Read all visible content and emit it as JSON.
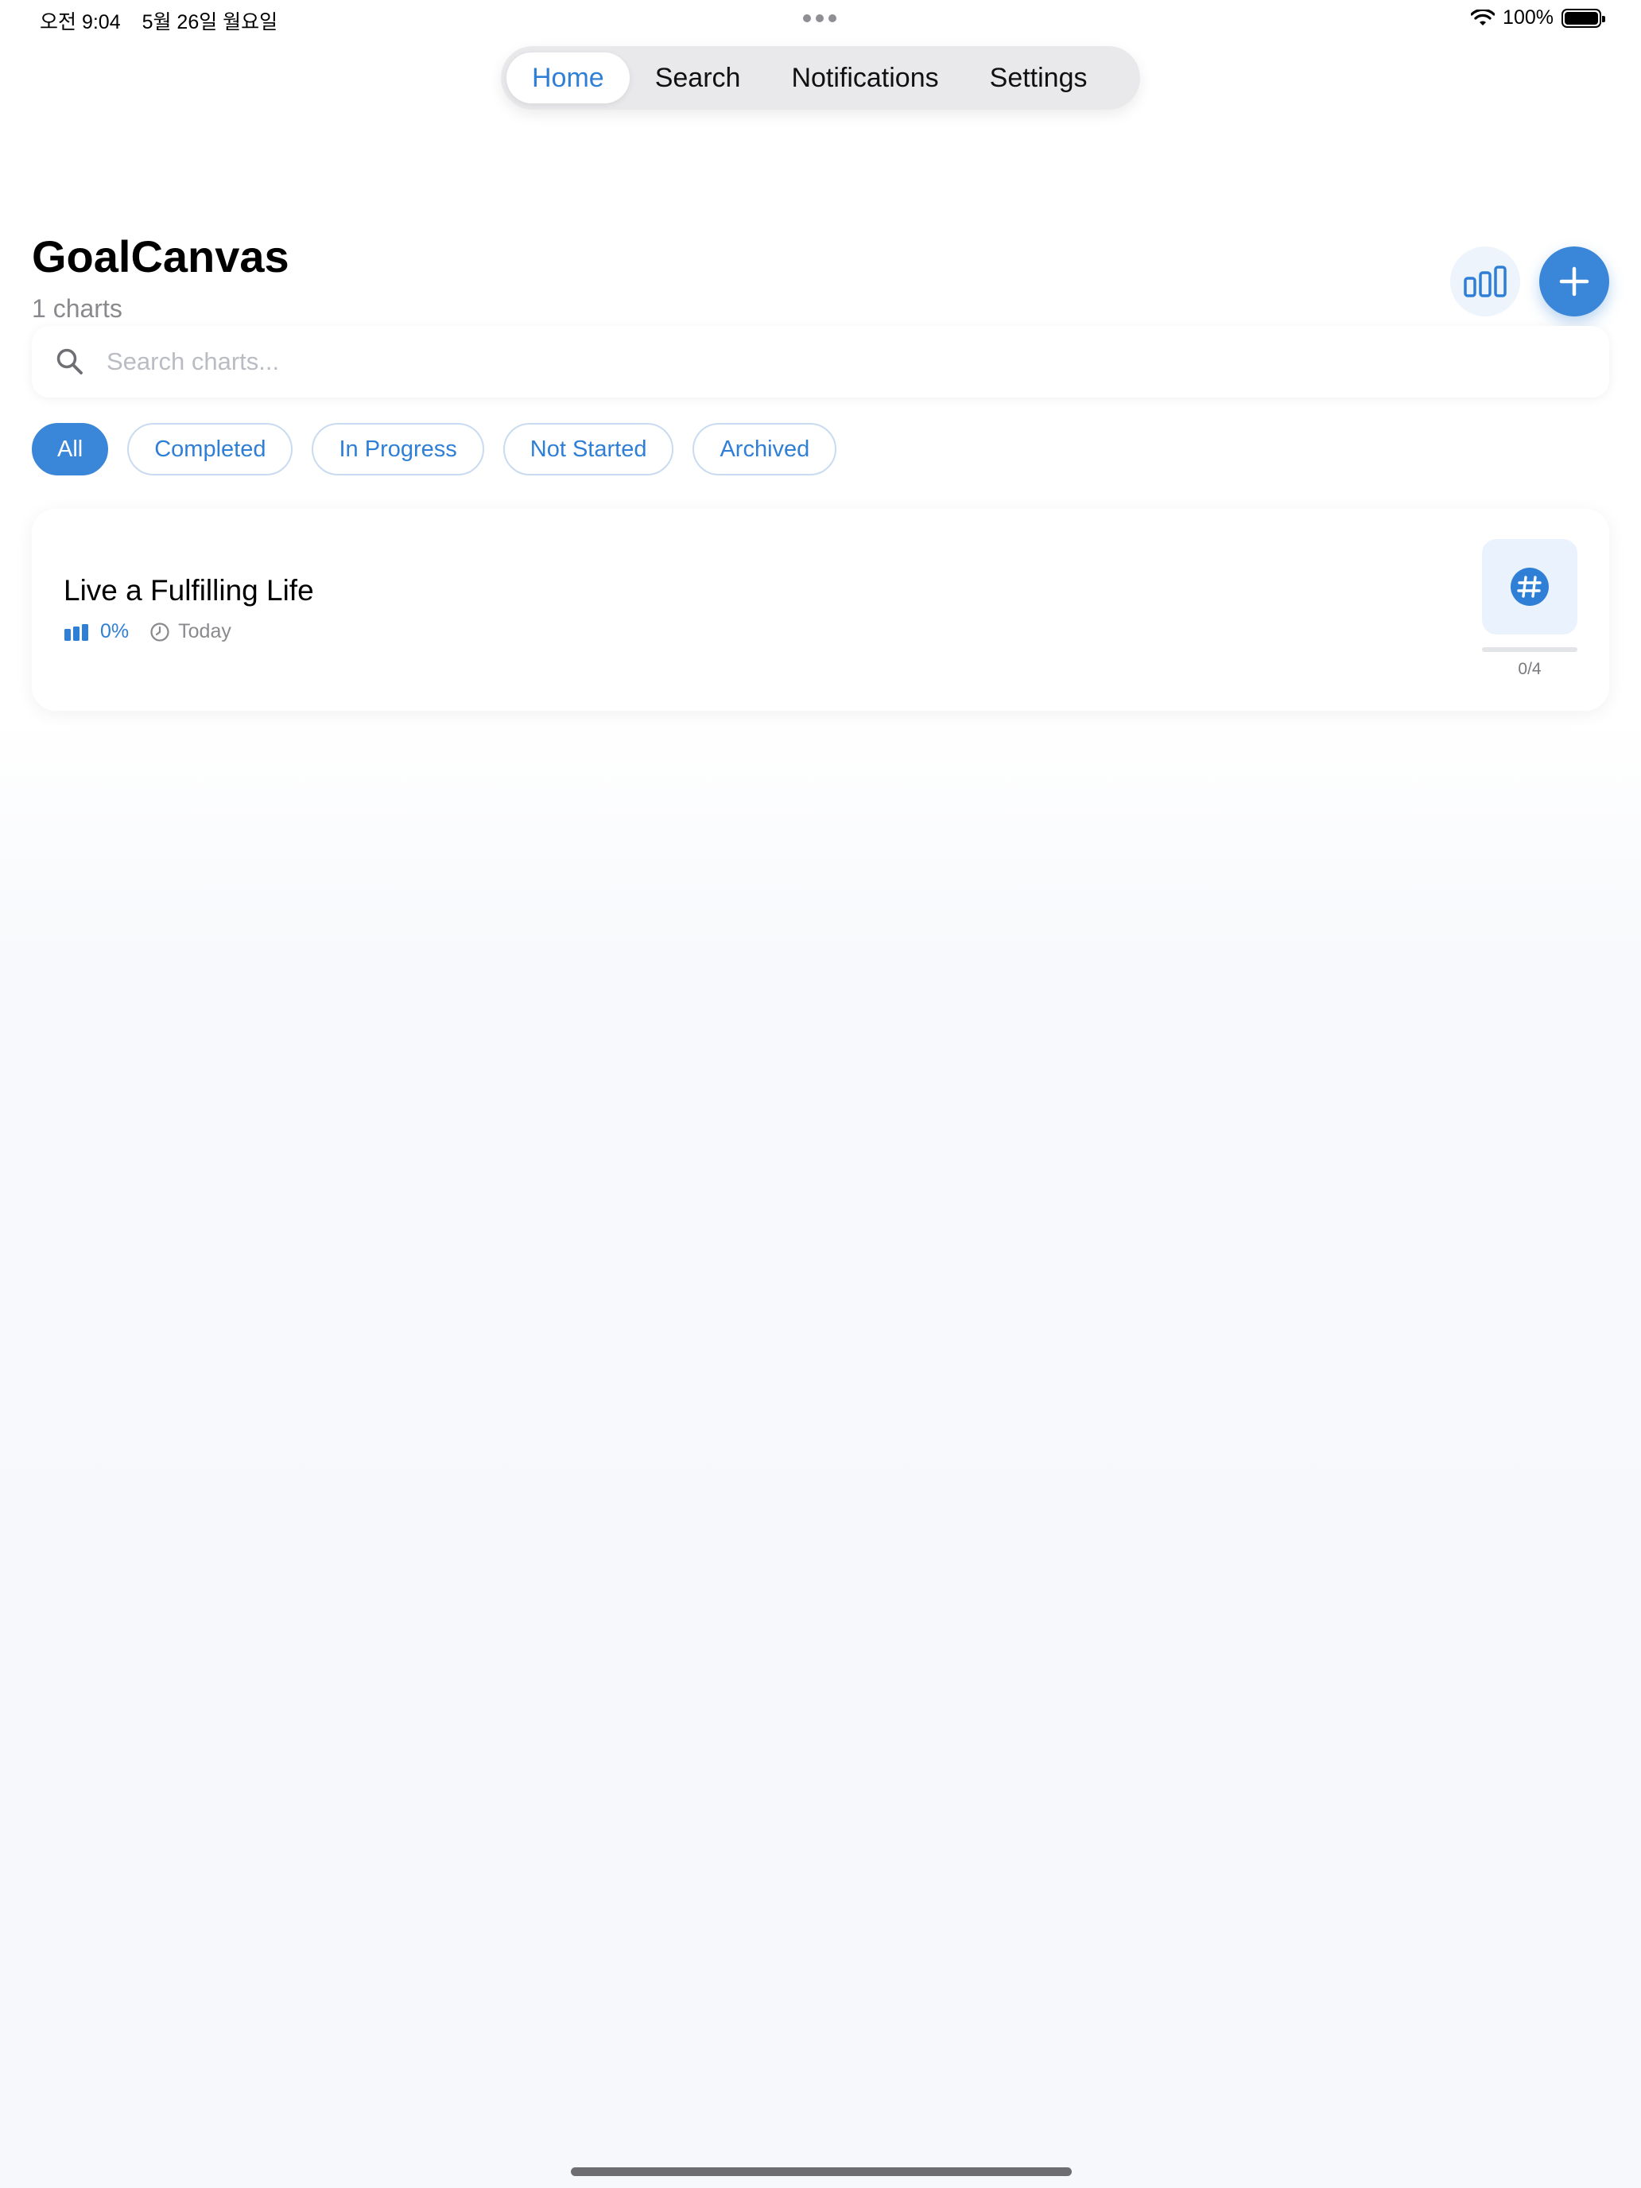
{
  "status_bar": {
    "time": "오전 9:04",
    "date": "5월 26일 월요일",
    "battery": "100%"
  },
  "tabs": [
    {
      "label": "Home",
      "active": true
    },
    {
      "label": "Search",
      "active": false
    },
    {
      "label": "Notifications",
      "active": false
    },
    {
      "label": "Settings",
      "active": false
    }
  ],
  "header": {
    "title": "GoalCanvas",
    "subtitle": "1 charts"
  },
  "search": {
    "placeholder": "Search charts..."
  },
  "filters": [
    {
      "label": "All",
      "active": true
    },
    {
      "label": "Completed",
      "active": false
    },
    {
      "label": "In Progress",
      "active": false
    },
    {
      "label": "Not Started",
      "active": false
    },
    {
      "label": "Archived",
      "active": false
    }
  ],
  "charts": [
    {
      "title": "Live a Fulfilling Life",
      "progress": "0%",
      "updated": "Today",
      "count": "0/4",
      "progress_fraction": 0
    }
  ],
  "colors": {
    "accent": "#3a86d8",
    "accent_text": "#2f7fd6",
    "icon_bg": "#eaf3fd"
  },
  "icons": {
    "stats": "bar-chart-icon",
    "add": "plus-icon",
    "search": "search-icon",
    "card_progress": "bar-chart-icon",
    "card_date": "clock-icon",
    "card_badge": "hashtag-icon"
  }
}
